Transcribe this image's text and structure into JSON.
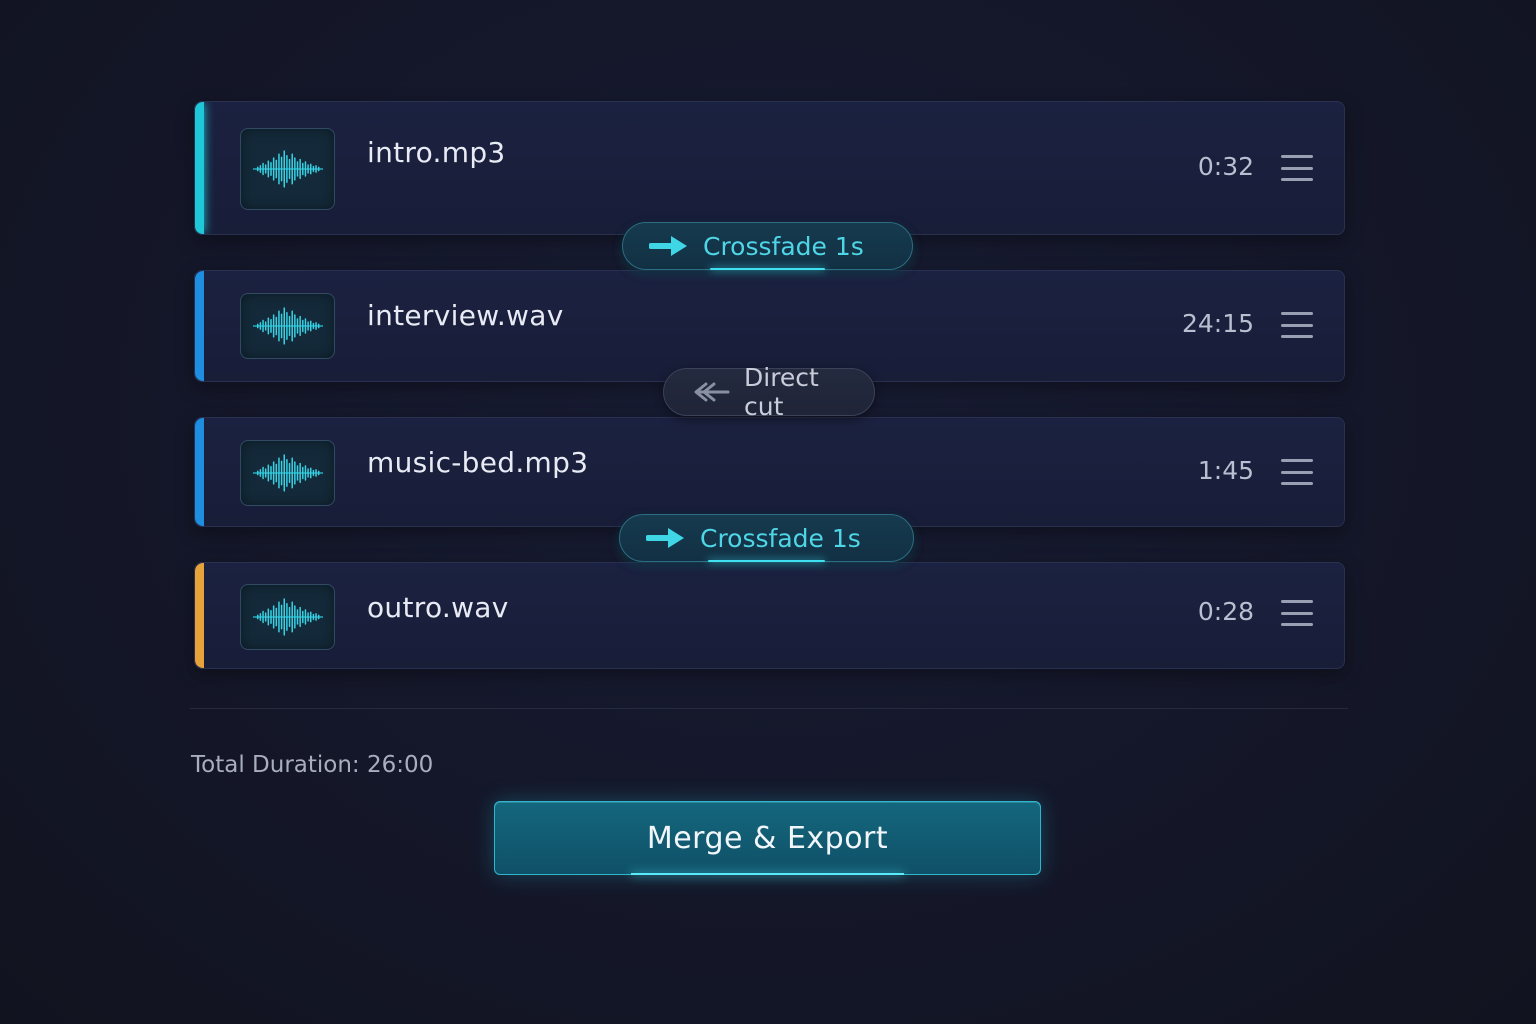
{
  "tracks": [
    {
      "filename": "intro.mp3",
      "duration": "0:32",
      "icon": "waveform-icon",
      "accent": "#1ec8d8"
    },
    {
      "filename": "interview.wav",
      "duration": "24:15",
      "icon": "waveform-icon",
      "accent": "#1e8ee0"
    },
    {
      "filename": "music-bed.mp3",
      "duration": "1:45",
      "icon": "waveform-icon",
      "accent": "#1e8ee0"
    },
    {
      "filename": "outro.wav",
      "duration": "0:28",
      "icon": "waveform-icon",
      "accent": "#e8a23a"
    }
  ],
  "transitions": [
    {
      "label": "Crossfade 1s",
      "icon": "arrow-right-icon"
    },
    {
      "label": "Direct cut",
      "icon": "arrow-left-icon"
    },
    {
      "label": "Crossfade 1s",
      "icon": "arrow-right-icon"
    }
  ],
  "summary": {
    "total_label": "Total Duration: 26:00"
  },
  "actions": {
    "export_label": "Merge & Export"
  },
  "colors": {
    "accent": "#3fd6e6",
    "background": "#141729",
    "card": "#1b2140"
  }
}
